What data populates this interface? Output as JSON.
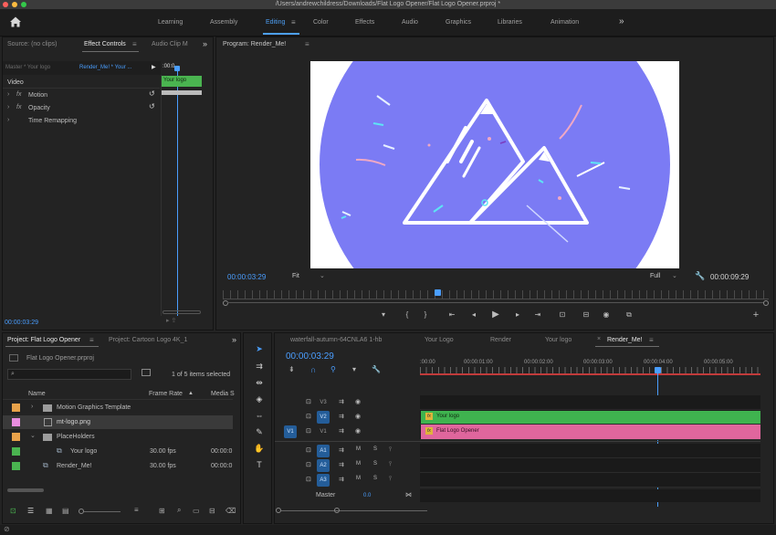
{
  "window": {
    "title": "/Users/andrewchildress/Downloads/Flat Logo Opener/Flat Logo Opener.prproj *",
    "traffic_colors": [
      "#fc605c",
      "#fdbc40",
      "#34c84a"
    ]
  },
  "workspaces": {
    "home_icon": "home-icon",
    "tabs": [
      "Learning",
      "Assembly",
      "Editing",
      "Color",
      "Effects",
      "Audio",
      "Graphics",
      "Libraries",
      "Animation"
    ],
    "active": "Editing",
    "overflow": "»"
  },
  "source_panel": {
    "tabs": [
      "Source: (no clips)",
      "Effect Controls",
      "Audio Clip M"
    ],
    "menu": "≡",
    "overflow": "»",
    "master_label": "Master * Your logo",
    "render_label": "Render_Me! * Your ...",
    "play_arrow": "▶",
    "timecode_start": ":00:0",
    "clip_label": "Your logo",
    "section": "Video",
    "effects": [
      {
        "fx": "fx",
        "name": "Motion"
      },
      {
        "fx": "fx",
        "name": "Opacity"
      },
      {
        "fx": "",
        "name": "Time Remapping"
      }
    ],
    "timecode": "00:00:03:29"
  },
  "program": {
    "title": "Program: Render_Me!",
    "menu": "≡",
    "timecode": "00:00:03:29",
    "fit": "Fit",
    "quality": "Full",
    "duration": "00:00:09:29",
    "bg_color": "#7b7bf4",
    "transport": [
      "▾",
      "{",
      "}",
      "⇤",
      "◂",
      "▶",
      "▸",
      "⇥",
      "⊡",
      "⊟",
      "⌘",
      "⧉"
    ],
    "add": "+"
  },
  "project_panel": {
    "tabs": [
      "Project: Flat Logo Opener",
      "Project: Cartoon Logo 4K_1"
    ],
    "menu": "≡",
    "overflow": "»",
    "file": "Flat Logo Opener.prproj",
    "selection_info": "1 of 5 items selected",
    "columns": [
      "Name",
      "Frame Rate",
      "Media S"
    ],
    "sort_arrow": "▲",
    "items": [
      {
        "name": "Motion Graphics Template",
        "color": "#e8a24a",
        "fps": "",
        "media": "",
        "indent": 1,
        "type": "folder"
      },
      {
        "name": "mt-logo.png",
        "color": "#e98de0",
        "fps": "",
        "media": "",
        "indent": 2,
        "type": "image"
      },
      {
        "name": "PlaceHolders",
        "color": "#e8a24a",
        "fps": "",
        "media": "",
        "indent": 1,
        "type": "folder"
      },
      {
        "name": "Your logo",
        "color": "#4ab450",
        "fps": "30.00 fps",
        "media": "00:00:0",
        "indent": 2,
        "type": "sequence"
      },
      {
        "name": "Render_Me!",
        "color": "#4ab450",
        "fps": "30.00 fps",
        "media": "00:00:0",
        "indent": 1,
        "type": "sequence"
      }
    ]
  },
  "timeline": {
    "tabs": [
      "waterfall-autumn-64CNLA6 1-hb",
      "Your Logo",
      "Render",
      "Your logo",
      "Render_Me!"
    ],
    "active": "Render_Me!",
    "close": "×",
    "menu": "≡",
    "timecode": "00:00:03:29",
    "ruler": [
      ":00:00",
      "00:00:01:00",
      "00:00:02:00",
      "00:00:03:00",
      "00:00:04:00",
      "00:00:05:00"
    ],
    "video_tracks": [
      "V3",
      "V2",
      "V1"
    ],
    "source_patch": "V1",
    "audio_tracks": [
      "A1",
      "A2",
      "A3"
    ],
    "mute": "M",
    "solo": "S",
    "master": "Master",
    "master_value": "0.0",
    "clips": [
      {
        "label": "Your logo",
        "fx": "fx",
        "color": "#3fb34f"
      },
      {
        "label": "Flat Logo Opener",
        "fx": "fx",
        "color": "#e0669d"
      }
    ]
  }
}
